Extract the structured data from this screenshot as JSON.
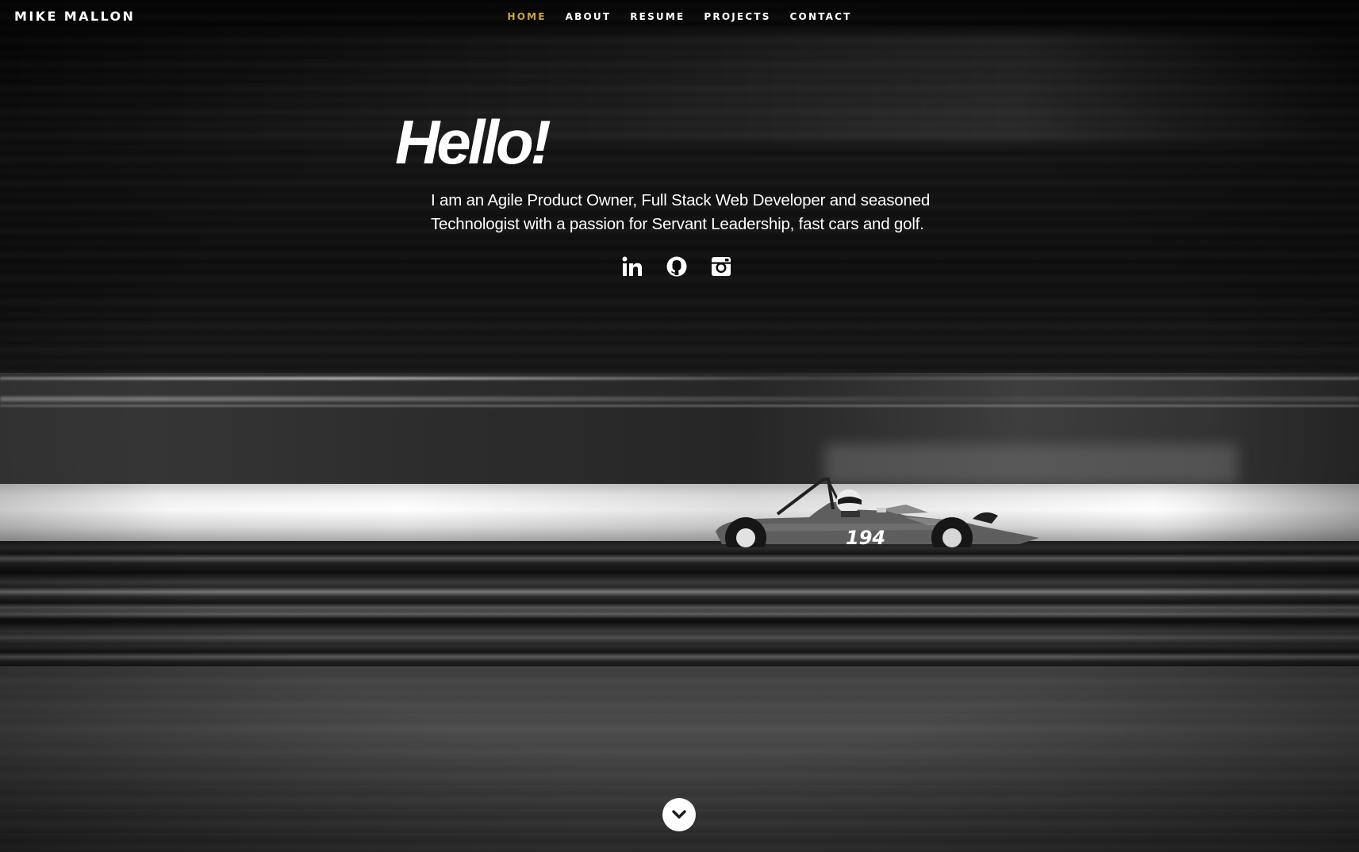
{
  "brand": {
    "name": "MIKE MALLON"
  },
  "nav": {
    "items": [
      {
        "label": "HOME",
        "active": true
      },
      {
        "label": "ABOUT",
        "active": false
      },
      {
        "label": "RESUME",
        "active": false
      },
      {
        "label": "PROJECTS",
        "active": false
      },
      {
        "label": "CONTACT",
        "active": false
      }
    ]
  },
  "hero": {
    "greeting": "Hello!",
    "tagline": "I am an Agile Product Owner, Full Stack Web Developer and seasoned Technologist with a passion for Servant Leadership, fast cars and golf.",
    "car_number": "194"
  },
  "social": {
    "icons": [
      "linkedin-icon",
      "github-icon",
      "instagram-icon"
    ]
  },
  "scroll": {
    "icon": "chevron-down-icon"
  },
  "colors": {
    "accent": "#c9a43c",
    "text": "#ffffff",
    "background": "#0b0b0b"
  }
}
